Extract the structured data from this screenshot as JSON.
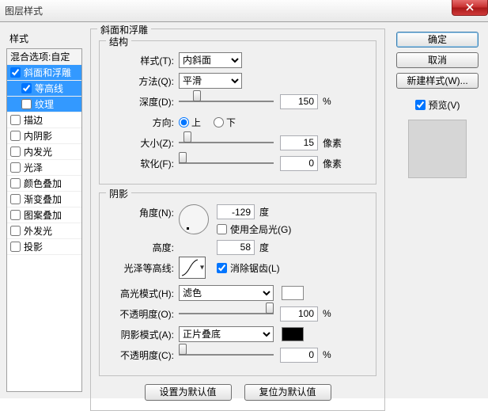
{
  "window": {
    "title": "图层样式"
  },
  "left": {
    "styles_label": "样式",
    "blend_label": "混合选项:自定",
    "items": [
      {
        "label": "斜面和浮雕",
        "checked": true,
        "sel": true
      },
      {
        "label": "等高线",
        "checked": true,
        "sub": true,
        "sel": true
      },
      {
        "label": "纹理",
        "checked": false,
        "sub": true,
        "sel": true
      },
      {
        "label": "描边",
        "checked": false
      },
      {
        "label": "内阴影",
        "checked": false
      },
      {
        "label": "内发光",
        "checked": false
      },
      {
        "label": "光泽",
        "checked": false
      },
      {
        "label": "颜色叠加",
        "checked": false
      },
      {
        "label": "渐变叠加",
        "checked": false
      },
      {
        "label": "图案叠加",
        "checked": false
      },
      {
        "label": "外发光",
        "checked": false
      },
      {
        "label": "投影",
        "checked": false
      }
    ]
  },
  "mid": {
    "group_title": "斜面和浮雕",
    "struct_title": "结构",
    "style_label": "样式(T):",
    "style_value": "内斜面",
    "method_label": "方法(Q):",
    "method_value": "平滑",
    "depth_label": "深度(D):",
    "depth_value": "150",
    "depth_unit": "%",
    "dir_label": "方向:",
    "dir_up": "上",
    "dir_down": "下",
    "size_label": "大小(Z):",
    "size_value": "15",
    "size_unit": "像素",
    "soften_label": "软化(F):",
    "soften_value": "0",
    "soften_unit": "像素",
    "shade_title": "阴影",
    "angle_label": "角度(N):",
    "angle_value": "-129",
    "angle_unit": "度",
    "global_label": "使用全局光(G)",
    "alt_label": "高度:",
    "alt_value": "58",
    "alt_unit": "度",
    "gloss_label": "光泽等高线:",
    "antialias_label": "消除锯齿(L)",
    "hl_mode_label": "高光模式(H):",
    "hl_mode_value": "滤色",
    "hl_op_label": "不透明度(O):",
    "hl_op_value": "100",
    "pct": "%",
    "sh_mode_label": "阴影模式(A):",
    "sh_mode_value": "正片叠底",
    "sh_op_label": "不透明度(C):",
    "sh_op_value": "0",
    "btn_default": "设置为默认值",
    "btn_reset": "复位为默认值"
  },
  "right": {
    "ok": "确定",
    "cancel": "取消",
    "newstyle": "新建样式(W)...",
    "preview_label": "预览(V)"
  }
}
